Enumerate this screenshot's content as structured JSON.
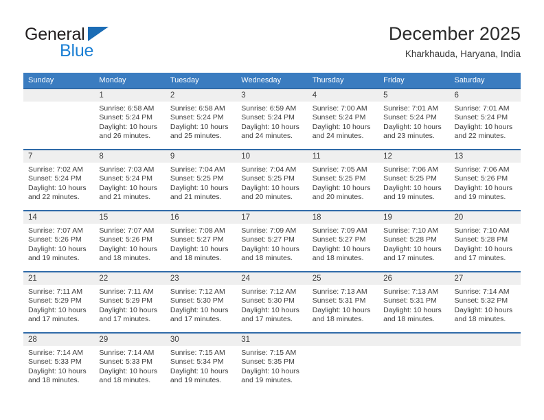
{
  "brand": {
    "name_part1": "General",
    "name_part2": "Blue"
  },
  "header": {
    "month_title": "December 2025",
    "location": "Kharkhauda, Haryana, India"
  },
  "colors": {
    "header_blue": "#3a7cc0",
    "row_border_blue": "#2f6aa8",
    "daynum_band": "#efefef",
    "brand_blue": "#1b7fd4",
    "text": "#3c3c3c"
  },
  "weekday_headers": [
    "Sunday",
    "Monday",
    "Tuesday",
    "Wednesday",
    "Thursday",
    "Friday",
    "Saturday"
  ],
  "labels": {
    "sunrise_prefix": "Sunrise: ",
    "sunset_prefix": "Sunset: ",
    "daylight_prefix": "Daylight: "
  },
  "weeks": [
    [
      {
        "day": "",
        "sunrise": "",
        "sunset": "",
        "daylight": "",
        "blank": true
      },
      {
        "day": "1",
        "sunrise": "Sunrise: 6:58 AM",
        "sunset": "Sunset: 5:24 PM",
        "daylight": "Daylight: 10 hours and 26 minutes."
      },
      {
        "day": "2",
        "sunrise": "Sunrise: 6:58 AM",
        "sunset": "Sunset: 5:24 PM",
        "daylight": "Daylight: 10 hours and 25 minutes."
      },
      {
        "day": "3",
        "sunrise": "Sunrise: 6:59 AM",
        "sunset": "Sunset: 5:24 PM",
        "daylight": "Daylight: 10 hours and 24 minutes."
      },
      {
        "day": "4",
        "sunrise": "Sunrise: 7:00 AM",
        "sunset": "Sunset: 5:24 PM",
        "daylight": "Daylight: 10 hours and 24 minutes."
      },
      {
        "day": "5",
        "sunrise": "Sunrise: 7:01 AM",
        "sunset": "Sunset: 5:24 PM",
        "daylight": "Daylight: 10 hours and 23 minutes."
      },
      {
        "day": "6",
        "sunrise": "Sunrise: 7:01 AM",
        "sunset": "Sunset: 5:24 PM",
        "daylight": "Daylight: 10 hours and 22 minutes."
      }
    ],
    [
      {
        "day": "7",
        "sunrise": "Sunrise: 7:02 AM",
        "sunset": "Sunset: 5:24 PM",
        "daylight": "Daylight: 10 hours and 22 minutes."
      },
      {
        "day": "8",
        "sunrise": "Sunrise: 7:03 AM",
        "sunset": "Sunset: 5:24 PM",
        "daylight": "Daylight: 10 hours and 21 minutes."
      },
      {
        "day": "9",
        "sunrise": "Sunrise: 7:04 AM",
        "sunset": "Sunset: 5:25 PM",
        "daylight": "Daylight: 10 hours and 21 minutes."
      },
      {
        "day": "10",
        "sunrise": "Sunrise: 7:04 AM",
        "sunset": "Sunset: 5:25 PM",
        "daylight": "Daylight: 10 hours and 20 minutes."
      },
      {
        "day": "11",
        "sunrise": "Sunrise: 7:05 AM",
        "sunset": "Sunset: 5:25 PM",
        "daylight": "Daylight: 10 hours and 20 minutes."
      },
      {
        "day": "12",
        "sunrise": "Sunrise: 7:06 AM",
        "sunset": "Sunset: 5:25 PM",
        "daylight": "Daylight: 10 hours and 19 minutes."
      },
      {
        "day": "13",
        "sunrise": "Sunrise: 7:06 AM",
        "sunset": "Sunset: 5:26 PM",
        "daylight": "Daylight: 10 hours and 19 minutes."
      }
    ],
    [
      {
        "day": "14",
        "sunrise": "Sunrise: 7:07 AM",
        "sunset": "Sunset: 5:26 PM",
        "daylight": "Daylight: 10 hours and 19 minutes."
      },
      {
        "day": "15",
        "sunrise": "Sunrise: 7:07 AM",
        "sunset": "Sunset: 5:26 PM",
        "daylight": "Daylight: 10 hours and 18 minutes."
      },
      {
        "day": "16",
        "sunrise": "Sunrise: 7:08 AM",
        "sunset": "Sunset: 5:27 PM",
        "daylight": "Daylight: 10 hours and 18 minutes."
      },
      {
        "day": "17",
        "sunrise": "Sunrise: 7:09 AM",
        "sunset": "Sunset: 5:27 PM",
        "daylight": "Daylight: 10 hours and 18 minutes."
      },
      {
        "day": "18",
        "sunrise": "Sunrise: 7:09 AM",
        "sunset": "Sunset: 5:27 PM",
        "daylight": "Daylight: 10 hours and 18 minutes."
      },
      {
        "day": "19",
        "sunrise": "Sunrise: 7:10 AM",
        "sunset": "Sunset: 5:28 PM",
        "daylight": "Daylight: 10 hours and 17 minutes."
      },
      {
        "day": "20",
        "sunrise": "Sunrise: 7:10 AM",
        "sunset": "Sunset: 5:28 PM",
        "daylight": "Daylight: 10 hours and 17 minutes."
      }
    ],
    [
      {
        "day": "21",
        "sunrise": "Sunrise: 7:11 AM",
        "sunset": "Sunset: 5:29 PM",
        "daylight": "Daylight: 10 hours and 17 minutes."
      },
      {
        "day": "22",
        "sunrise": "Sunrise: 7:11 AM",
        "sunset": "Sunset: 5:29 PM",
        "daylight": "Daylight: 10 hours and 17 minutes."
      },
      {
        "day": "23",
        "sunrise": "Sunrise: 7:12 AM",
        "sunset": "Sunset: 5:30 PM",
        "daylight": "Daylight: 10 hours and 17 minutes."
      },
      {
        "day": "24",
        "sunrise": "Sunrise: 7:12 AM",
        "sunset": "Sunset: 5:30 PM",
        "daylight": "Daylight: 10 hours and 17 minutes."
      },
      {
        "day": "25",
        "sunrise": "Sunrise: 7:13 AM",
        "sunset": "Sunset: 5:31 PM",
        "daylight": "Daylight: 10 hours and 18 minutes."
      },
      {
        "day": "26",
        "sunrise": "Sunrise: 7:13 AM",
        "sunset": "Sunset: 5:31 PM",
        "daylight": "Daylight: 10 hours and 18 minutes."
      },
      {
        "day": "27",
        "sunrise": "Sunrise: 7:14 AM",
        "sunset": "Sunset: 5:32 PM",
        "daylight": "Daylight: 10 hours and 18 minutes."
      }
    ],
    [
      {
        "day": "28",
        "sunrise": "Sunrise: 7:14 AM",
        "sunset": "Sunset: 5:33 PM",
        "daylight": "Daylight: 10 hours and 18 minutes."
      },
      {
        "day": "29",
        "sunrise": "Sunrise: 7:14 AM",
        "sunset": "Sunset: 5:33 PM",
        "daylight": "Daylight: 10 hours and 18 minutes."
      },
      {
        "day": "30",
        "sunrise": "Sunrise: 7:15 AM",
        "sunset": "Sunset: 5:34 PM",
        "daylight": "Daylight: 10 hours and 19 minutes."
      },
      {
        "day": "31",
        "sunrise": "Sunrise: 7:15 AM",
        "sunset": "Sunset: 5:35 PM",
        "daylight": "Daylight: 10 hours and 19 minutes."
      },
      {
        "day": "",
        "sunrise": "",
        "sunset": "",
        "daylight": "",
        "blank": true
      },
      {
        "day": "",
        "sunrise": "",
        "sunset": "",
        "daylight": "",
        "blank": true
      },
      {
        "day": "",
        "sunrise": "",
        "sunset": "",
        "daylight": "",
        "blank": true
      }
    ]
  ]
}
